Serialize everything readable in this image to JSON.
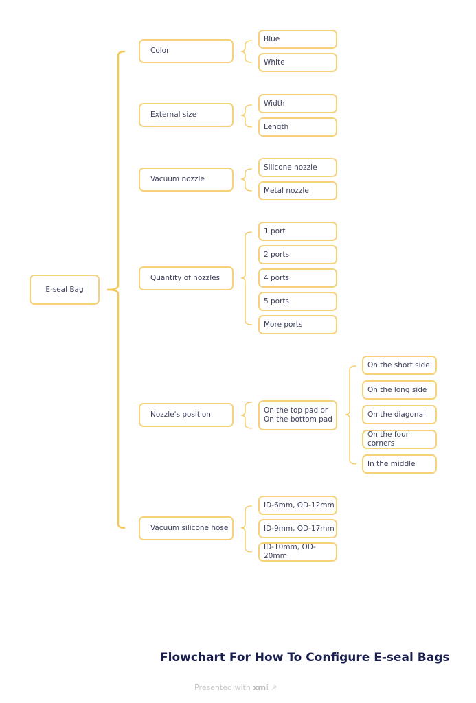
{
  "root": {
    "label": "E-seal Bag"
  },
  "branches": [
    {
      "label": "Color",
      "children": [
        {
          "label": "Blue"
        },
        {
          "label": "White"
        }
      ]
    },
    {
      "label": "External size",
      "children": [
        {
          "label": "Width"
        },
        {
          "label": "Length"
        }
      ]
    },
    {
      "label": "Vacuum nozzle",
      "children": [
        {
          "label": "Silicone nozzle"
        },
        {
          "label": "Metal nozzle"
        }
      ]
    },
    {
      "label": "Quantity of nozzles",
      "children": [
        {
          "label": "1 port"
        },
        {
          "label": "2 ports"
        },
        {
          "label": "4 ports"
        },
        {
          "label": "5 ports"
        },
        {
          "label": "More ports"
        }
      ]
    },
    {
      "label": "Nozzle's position",
      "children": [
        {
          "label": "On the top pad or\nOn the bottom pad",
          "children": [
            {
              "label": "On the short side"
            },
            {
              "label": "On the long side"
            },
            {
              "label": "On the diagonal"
            },
            {
              "label": "On the four corners"
            },
            {
              "label": "In the middle"
            }
          ]
        }
      ]
    },
    {
      "label": "Vacuum silicone hose",
      "children": [
        {
          "label": "ID-6mm, OD-12mm"
        },
        {
          "label": "ID-9mm, OD-17mm"
        },
        {
          "label": "ID-10mm, OD-20mm"
        }
      ]
    }
  ],
  "title": "Flowchart For How To Configure E-seal Bags",
  "credit": {
    "prefix": "Presented with",
    "brand": "xmi",
    "icon": "external-link-icon"
  },
  "colors": {
    "border": "#f5d27a",
    "connector": "#f5c85a",
    "text": "#3b3f5c",
    "title": "#1a1f4d"
  }
}
